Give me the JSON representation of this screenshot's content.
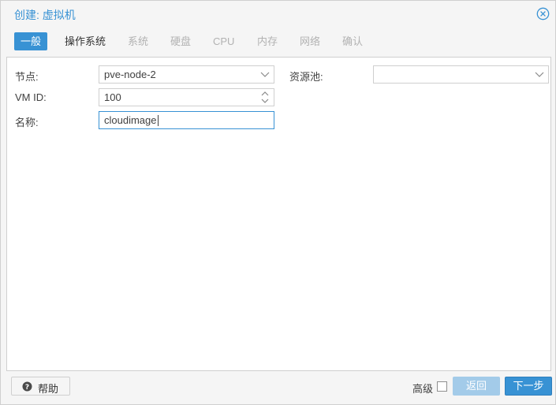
{
  "window": {
    "title": "创建: 虚拟机"
  },
  "tabs": [
    {
      "label": "一般",
      "state": "active"
    },
    {
      "label": "操作系统",
      "state": "normal"
    },
    {
      "label": "系统",
      "state": "disabled"
    },
    {
      "label": "硬盘",
      "state": "disabled"
    },
    {
      "label": "CPU",
      "state": "disabled"
    },
    {
      "label": "内存",
      "state": "disabled"
    },
    {
      "label": "网络",
      "state": "disabled"
    },
    {
      "label": "确认",
      "state": "disabled"
    }
  ],
  "form": {
    "node_label": "节点:",
    "node_value": "pve-node-2",
    "vmid_label": "VM ID:",
    "vmid_value": "100",
    "name_label": "名称:",
    "name_value": "cloudimage",
    "pool_label": "资源池:",
    "pool_value": ""
  },
  "footer": {
    "help_label": "帮助",
    "advanced_label": "高级",
    "back_label": "返回",
    "next_label": "下一步"
  },
  "colors": {
    "accent": "#3892d4",
    "disabled_text": "#b2b2b2",
    "back_disabled": "#a3cbe9"
  },
  "icons": {
    "close": "close-circle-icon",
    "help": "question-circle-icon",
    "dropdown": "chevron-down-icon",
    "spinner": "spinner-arrows-icon"
  }
}
